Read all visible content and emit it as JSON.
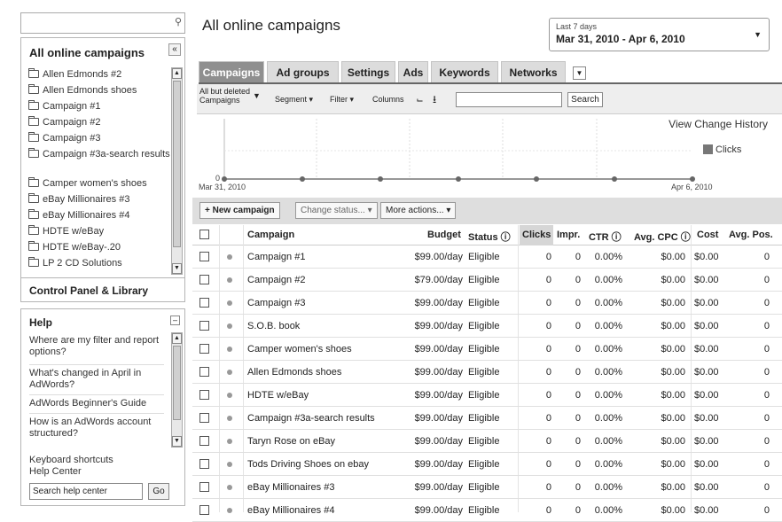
{
  "sidebar": {
    "search_placeholder": "",
    "campaigns_panel": {
      "title": "All online campaigns",
      "collapse_symbol": "«",
      "items": [
        "Allen Edmonds #2",
        "Allen Edmonds shoes",
        "Campaign #1",
        "Campaign #2",
        "Campaign #3",
        "Campaign #3a-search results",
        "Camper women's shoes",
        "eBay Millionaires #3",
        "eBay Millionaires #4",
        "HDTE w/eBay",
        "HDTE w/eBay-.20",
        "LP 2 CD Solutions"
      ],
      "footer": "Control Panel & Library"
    },
    "help_panel": {
      "title": "Help",
      "links": [
        "Where are my filter and report options?",
        "What's changed in April in AdWords?",
        "AdWords Beginner's Guide",
        "How is an AdWords account structured?"
      ],
      "keyboard_shortcuts": "Keyboard shortcuts",
      "help_center": "Help Center",
      "search_placeholder": "Search help center",
      "go_label": "Go"
    }
  },
  "main": {
    "title": "All online campaigns",
    "date_range": {
      "label": "Last 7 days",
      "value": "Mar 31, 2010 - Apr 6, 2010"
    },
    "tabs": [
      {
        "label": "Campaigns",
        "active": true
      },
      {
        "label": "Ad groups",
        "active": false
      },
      {
        "label": "Settings",
        "active": false
      },
      {
        "label": "Ads",
        "active": false
      },
      {
        "label": "Keywords",
        "active": false
      },
      {
        "label": "Networks",
        "active": false
      }
    ],
    "toolbar": {
      "filter_line1": "All but deleted",
      "filter_line2": "Campaigns",
      "segment": "Segment ▾",
      "filter": "Filter ▾",
      "columns": "Columns",
      "search_label": "Search"
    },
    "chart": {
      "view_history": "View Change History",
      "legend": "Clicks",
      "y_zero": "0",
      "x_start": "Mar 31, 2010",
      "x_end": "Apr 6, 2010"
    },
    "actions": {
      "new_campaign": "+ New campaign",
      "change_status": "Change status... ▾",
      "more_actions": "More actions... ▾"
    },
    "table": {
      "headers": {
        "campaign": "Campaign",
        "budget": "Budget",
        "status": "Status ⓘ",
        "clicks": "Clicks",
        "impr": "Impr.",
        "ctr": "CTR ⓘ",
        "avg_cpc": "Avg. CPC ⓘ",
        "cost": "Cost",
        "avg_pos": "Avg. Pos."
      },
      "rows": [
        {
          "campaign": "Campaign #1",
          "budget": "$99.00/day",
          "status": "Eligible",
          "clicks": "0",
          "impr": "0",
          "ctr": "0.00%",
          "avg_cpc": "$0.00",
          "cost": "$0.00",
          "avg_pos": "0"
        },
        {
          "campaign": "Campaign #2",
          "budget": "$79.00/day",
          "status": "Eligible",
          "clicks": "0",
          "impr": "0",
          "ctr": "0.00%",
          "avg_cpc": "$0.00",
          "cost": "$0.00",
          "avg_pos": "0"
        },
        {
          "campaign": "Campaign #3",
          "budget": "$99.00/day",
          "status": "Eligible",
          "clicks": "0",
          "impr": "0",
          "ctr": "0.00%",
          "avg_cpc": "$0.00",
          "cost": "$0.00",
          "avg_pos": "0"
        },
        {
          "campaign": "S.O.B. book",
          "budget": "$99.00/day",
          "status": "Eligible",
          "clicks": "0",
          "impr": "0",
          "ctr": "0.00%",
          "avg_cpc": "$0.00",
          "cost": "$0.00",
          "avg_pos": "0"
        },
        {
          "campaign": "Camper women's shoes",
          "budget": "$99.00/day",
          "status": "Eligible",
          "clicks": "0",
          "impr": "0",
          "ctr": "0.00%",
          "avg_cpc": "$0.00",
          "cost": "$0.00",
          "avg_pos": "0"
        },
        {
          "campaign": "Allen Edmonds shoes",
          "budget": "$99.00/day",
          "status": "Eligible",
          "clicks": "0",
          "impr": "0",
          "ctr": "0.00%",
          "avg_cpc": "$0.00",
          "cost": "$0.00",
          "avg_pos": "0"
        },
        {
          "campaign": "HDTE w/eBay",
          "budget": "$99.00/day",
          "status": "Eligible",
          "clicks": "0",
          "impr": "0",
          "ctr": "0.00%",
          "avg_cpc": "$0.00",
          "cost": "$0.00",
          "avg_pos": "0"
        },
        {
          "campaign": "Campaign #3a-search results",
          "budget": "$99.00/day",
          "status": "Eligible",
          "clicks": "0",
          "impr": "0",
          "ctr": "0.00%",
          "avg_cpc": "$0.00",
          "cost": "$0.00",
          "avg_pos": "0"
        },
        {
          "campaign": "Taryn Rose on eBay",
          "budget": "$99.00/day",
          "status": "Eligible",
          "clicks": "0",
          "impr": "0",
          "ctr": "0.00%",
          "avg_cpc": "$0.00",
          "cost": "$0.00",
          "avg_pos": "0"
        },
        {
          "campaign": "Tods Driving Shoes on ebay",
          "budget": "$99.00/day",
          "status": "Eligible",
          "clicks": "0",
          "impr": "0",
          "ctr": "0.00%",
          "avg_cpc": "$0.00",
          "cost": "$0.00",
          "avg_pos": "0"
        },
        {
          "campaign": "eBay Millionaires #3",
          "budget": "$99.00/day",
          "status": "Eligible",
          "clicks": "0",
          "impr": "0",
          "ctr": "0.00%",
          "avg_cpc": "$0.00",
          "cost": "$0.00",
          "avg_pos": "0"
        },
        {
          "campaign": "eBay Millionaires #4",
          "budget": "$99.00/day",
          "status": "Eligible",
          "clicks": "0",
          "impr": "0",
          "ctr": "0.00%",
          "avg_cpc": "$0.00",
          "cost": "$0.00",
          "avg_pos": "0"
        }
      ]
    }
  },
  "colors": {
    "active_tab": "#8f8f8f",
    "tab": "#dcdcdc",
    "toolbar": "#eeeeee",
    "status_dot": "#999999"
  }
}
